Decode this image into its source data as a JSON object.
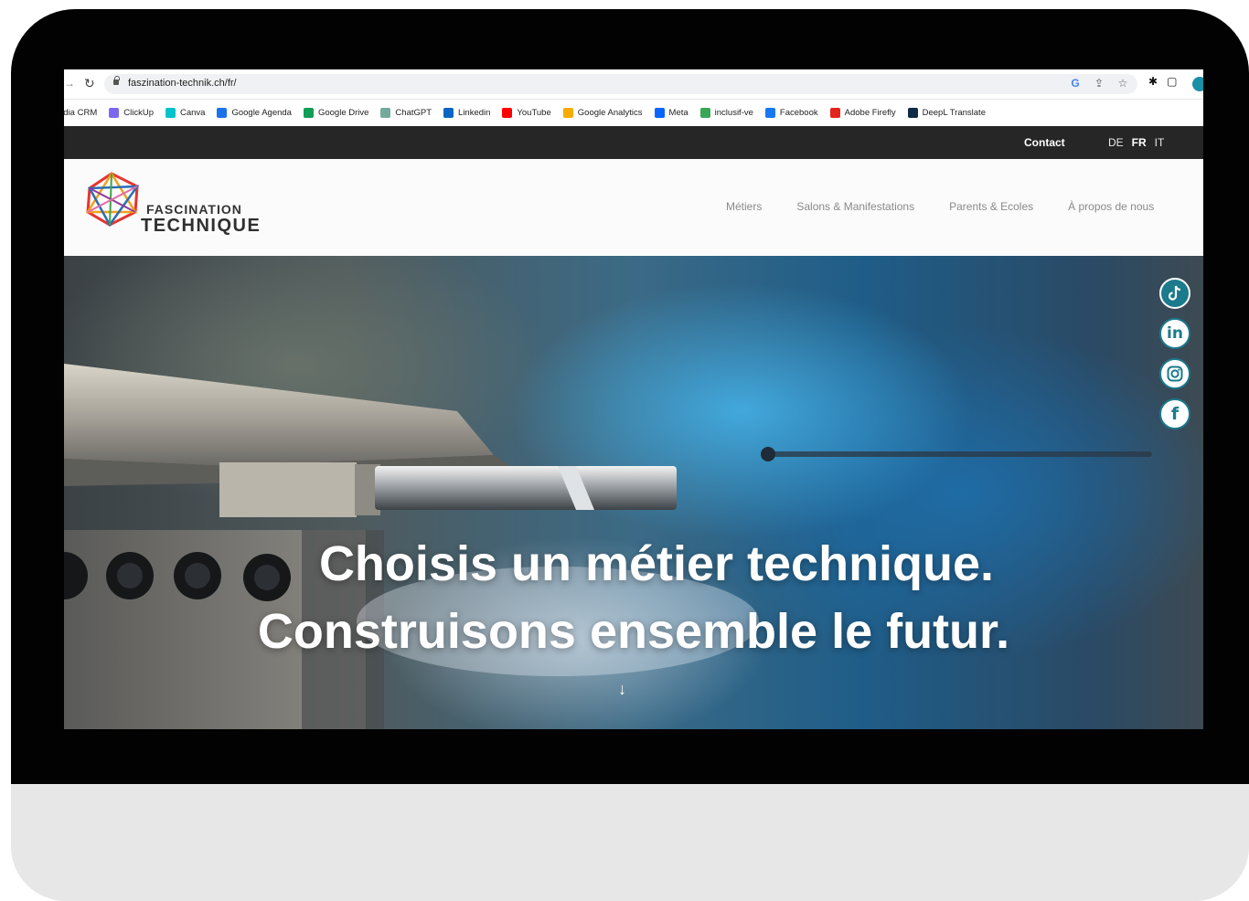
{
  "browser": {
    "url": "faszination-technik.ch/fr/",
    "bookmarks": [
      {
        "label": "edia CRM",
        "icon": "crm-icon",
        "color": "#888888"
      },
      {
        "label": "ClickUp",
        "icon": "clickup-icon",
        "color": "#7b68ee"
      },
      {
        "label": "Canva",
        "icon": "canva-icon",
        "color": "#00c4cc"
      },
      {
        "label": "Google Agenda",
        "icon": "google-calendar-icon",
        "color": "#1a73e8"
      },
      {
        "label": "Google Drive",
        "icon": "google-drive-icon",
        "color": "#0f9d58"
      },
      {
        "label": "ChatGPT",
        "icon": "chatgpt-icon",
        "color": "#74aa9c"
      },
      {
        "label": "Linkedin",
        "icon": "linkedin-icon",
        "color": "#0a66c2"
      },
      {
        "label": "YouTube",
        "icon": "youtube-icon",
        "color": "#ff0000"
      },
      {
        "label": "Google Analytics",
        "icon": "google-analytics-icon",
        "color": "#f9ab00"
      },
      {
        "label": "Meta",
        "icon": "meta-icon",
        "color": "#0866ff"
      },
      {
        "label": "inclusif-ve",
        "icon": "inclusif-icon",
        "color": "#3aa655"
      },
      {
        "label": "Facebook",
        "icon": "facebook-icon",
        "color": "#1877f2"
      },
      {
        "label": "Adobe Firefly",
        "icon": "adobe-firefly-icon",
        "color": "#e1251b"
      },
      {
        "label": "DeepL Translate",
        "icon": "deepl-icon",
        "color": "#0f2b46"
      }
    ]
  },
  "topbar": {
    "contact": "Contact",
    "languages": [
      {
        "code": "DE",
        "active": false
      },
      {
        "code": "FR",
        "active": true
      },
      {
        "code": "IT",
        "active": false
      }
    ]
  },
  "header": {
    "logo_line1": "FASCINATION",
    "logo_line2": "TECHNIQUE",
    "nav": [
      "Métiers",
      "Salons & Manifestations",
      "Parents & Ecoles",
      "À propos de nous"
    ]
  },
  "hero": {
    "title_line1": "Choisis un métier technique.",
    "title_line2": "Construisons ensemble le futur.",
    "scroll_icon": "arrow-down-icon"
  },
  "social": [
    "tiktok-icon",
    "linkedin-icon",
    "instagram-icon",
    "facebook-icon"
  ],
  "colors": {
    "topbar_bg": "#262626",
    "accent_teal": "#1b7a8c",
    "bezel": "#020202"
  }
}
